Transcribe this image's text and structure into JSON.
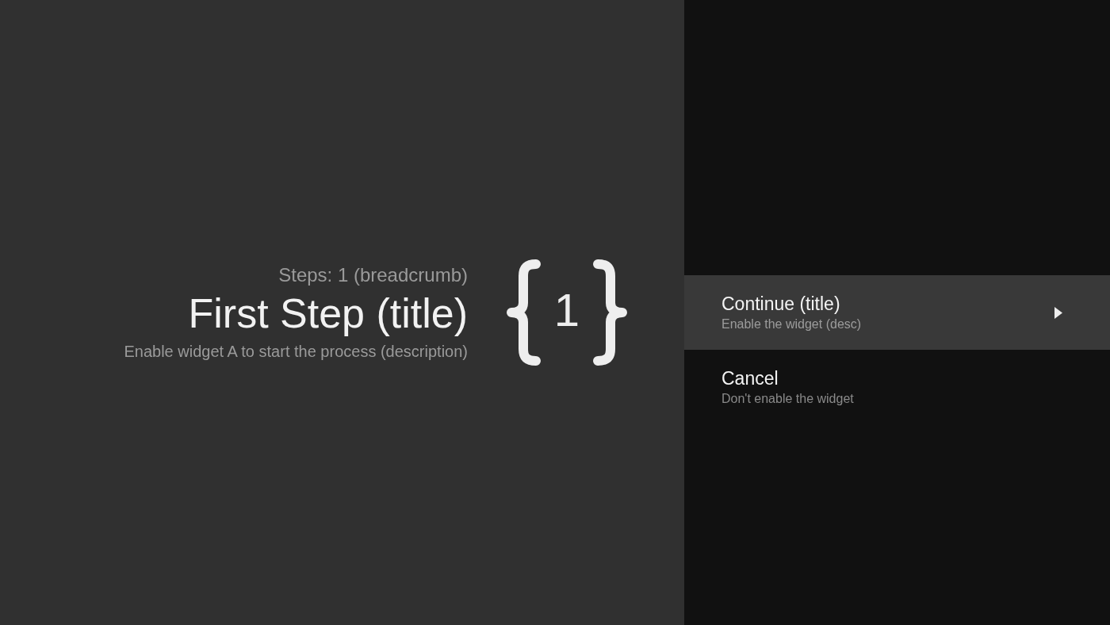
{
  "guidance": {
    "breadcrumb": "Steps: 1 (breadcrumb)",
    "title": "First Step (title)",
    "description": "Enable widget A to start the process (description)",
    "icon_number": "1"
  },
  "actions": [
    {
      "title": "Continue (title)",
      "description": "Enable the widget (desc)",
      "selected": true,
      "has_next": true
    },
    {
      "title": "Cancel",
      "description": "Don't enable the widget",
      "selected": false,
      "has_next": false
    }
  ]
}
